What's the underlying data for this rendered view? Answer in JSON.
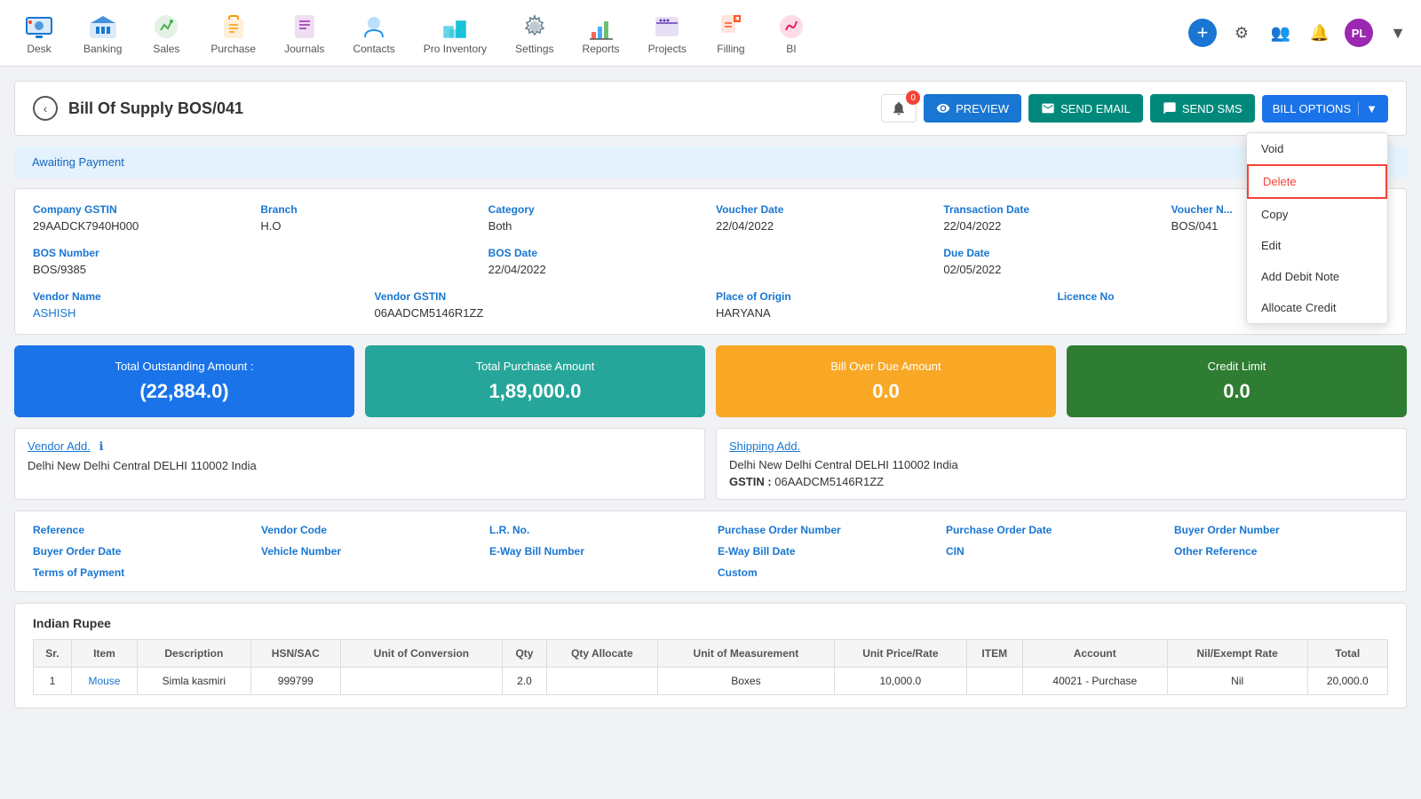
{
  "nav": {
    "items": [
      {
        "id": "desk",
        "label": "Desk",
        "icon": "desk"
      },
      {
        "id": "banking",
        "label": "Banking",
        "icon": "banking"
      },
      {
        "id": "sales",
        "label": "Sales",
        "icon": "sales"
      },
      {
        "id": "purchase",
        "label": "Purchase",
        "icon": "purchase"
      },
      {
        "id": "journals",
        "label": "Journals",
        "icon": "journals"
      },
      {
        "id": "contacts",
        "label": "Contacts",
        "icon": "contacts"
      },
      {
        "id": "pro-inventory",
        "label": "Pro Inventory",
        "icon": "pro-inventory"
      },
      {
        "id": "settings",
        "label": "Settings",
        "icon": "settings"
      },
      {
        "id": "reports",
        "label": "Reports",
        "icon": "reports"
      },
      {
        "id": "projects",
        "label": "Projects",
        "icon": "projects"
      },
      {
        "id": "filling",
        "label": "Filling",
        "icon": "filling"
      },
      {
        "id": "bi",
        "label": "BI",
        "icon": "bi"
      }
    ],
    "user_initials": "PL"
  },
  "page": {
    "title": "Bill Of Supply BOS/041",
    "notification_count": "0",
    "status": "Awaiting Payment"
  },
  "actions": {
    "preview": "PREVIEW",
    "send_email": "SEND EMAIL",
    "send_sms": "SEND SMS",
    "bill_options": "BILL OPTIONS"
  },
  "dropdown_menu": {
    "items": [
      {
        "id": "void",
        "label": "Void",
        "highlighted": false
      },
      {
        "id": "delete",
        "label": "Delete",
        "highlighted": true
      },
      {
        "id": "copy",
        "label": "Copy",
        "highlighted": false
      },
      {
        "id": "edit",
        "label": "Edit",
        "highlighted": false
      },
      {
        "id": "add-debit-note",
        "label": "Add Debit Note",
        "highlighted": false
      },
      {
        "id": "allocate-credit",
        "label": "Allocate Credit",
        "highlighted": false
      }
    ]
  },
  "company_info": {
    "company_gstin_label": "Company GSTIN",
    "company_gstin_value": "29AADCK7940H000",
    "branch_label": "Branch",
    "branch_value": "H.O",
    "category_label": "Category",
    "category_value": "Both",
    "voucher_date_label": "Voucher Date",
    "voucher_date_value": "22/04/2022",
    "transaction_date_label": "Transaction Date",
    "transaction_date_value": "22/04/2022",
    "voucher_number_label": "Voucher N...",
    "voucher_number_value": "BOS/041",
    "bos_number_label": "BOS Number",
    "bos_number_value": "BOS/9385",
    "bos_date_label": "BOS Date",
    "bos_date_value": "22/04/2022",
    "due_date_label": "Due Date",
    "due_date_value": "02/05/2022",
    "vendor_name_label": "Vendor Name",
    "vendor_name_value": "ASHISH",
    "vendor_gstin_label": "Vendor GSTIN",
    "vendor_gstin_value": "06AADCM5146R1ZZ",
    "place_of_origin_label": "Place of Origin",
    "place_of_origin_value": "HARYANA",
    "licence_no_label": "Licence No",
    "licence_no_value": ""
  },
  "summary_cards": {
    "total_outstanding_label": "Total Outstanding Amount :",
    "total_outstanding_value": "(22,884.0)",
    "total_purchase_label": "Total Purchase Amount",
    "total_purchase_value": "1,89,000.0",
    "bill_overdue_label": "Bill Over Due Amount",
    "bill_overdue_value": "0.0",
    "credit_limit_label": "Credit Limit",
    "credit_limit_value": "0.0"
  },
  "addresses": {
    "vendor_add_label": "Vendor Add.",
    "vendor_add_text": "Delhi New Delhi Central DELHI 110002 India",
    "shipping_add_label": "Shipping Add.",
    "shipping_add_text": "Delhi New Delhi Central DELHI 110002 India",
    "shipping_gstin_label": "GSTIN :",
    "shipping_gstin_value": "06AADCM5146R1ZZ"
  },
  "reference_fields": {
    "reference_label": "Reference",
    "reference_value": "",
    "vendor_code_label": "Vendor Code",
    "vendor_code_value": "",
    "lr_no_label": "L.R. No.",
    "lr_no_value": "",
    "purchase_order_number_label": "Purchase Order Number",
    "purchase_order_number_value": "",
    "purchase_order_date_label": "Purchase Order Date",
    "purchase_order_date_value": "",
    "buyer_order_number_label": "Buyer Order Number",
    "buyer_order_number_value": "",
    "buyer_order_date_label": "Buyer Order Date",
    "buyer_order_date_value": "",
    "vehicle_number_label": "Vehicle Number",
    "vehicle_number_value": "",
    "eway_bill_number_label": "E-Way Bill Number",
    "eway_bill_number_value": "",
    "eway_bill_date_label": "E-Way Bill Date",
    "eway_bill_date_value": "",
    "cin_label": "CIN",
    "cin_value": "",
    "other_reference_label": "Other Reference",
    "other_reference_value": "",
    "terms_of_payment_label": "Terms of Payment",
    "terms_of_payment_value": "",
    "custom_label": "Custom",
    "custom_value": ""
  },
  "table": {
    "currency": "Indian Rupee",
    "columns": [
      "Sr.",
      "Item",
      "Description",
      "HSN/SAC",
      "Unit of Conversion",
      "Qty",
      "Qty Allocate",
      "Unit of Measurement",
      "Unit Price/Rate",
      "ITEM",
      "Account",
      "Nil/Exempt Rate",
      "Total"
    ],
    "rows": [
      {
        "sr": "1",
        "item": "Mouse",
        "description": "Simla kasmiri",
        "hsn_sac": "999799",
        "unit_conversion": "",
        "qty": "2.0",
        "qty_allocate": "",
        "unit_measurement": "Boxes",
        "unit_price": "10,000.0",
        "item_col": "",
        "account": "40021 - Purchase",
        "nil_exempt": "Nil",
        "total": "20,000.0"
      }
    ]
  }
}
